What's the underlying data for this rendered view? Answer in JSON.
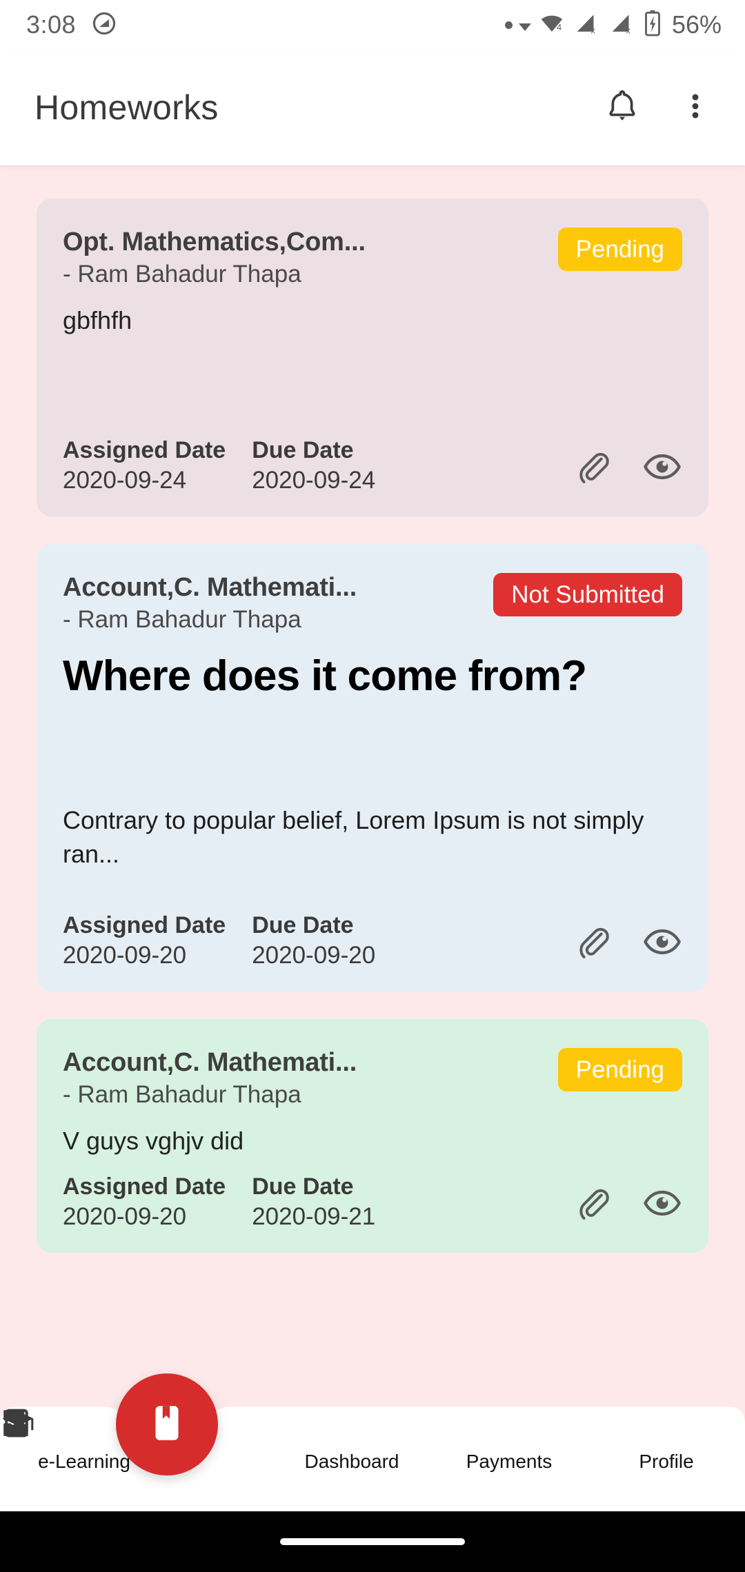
{
  "status_bar": {
    "time": "3:08",
    "battery_percent": "56%",
    "dnd_icon": "do-not-disturb-icon",
    "wifi_label": "4",
    "signal1_label": "x",
    "signal2_label": "x"
  },
  "app_bar": {
    "title": "Homeworks",
    "notification_icon": "bell-icon",
    "overflow_icon": "more-vertical-icon"
  },
  "colors": {
    "page_background": "#fde9e9",
    "badge_pending": "#ffc709",
    "badge_not_submitted": "#e03131",
    "fab": "#d62c2c",
    "card1_bg": "#ece0e4",
    "card2_bg": "#e6eef5",
    "card3_bg": "#d7f2e0"
  },
  "labels": {
    "assigned_date": "Assigned Date",
    "due_date": "Due Date",
    "attachment_icon": "paperclip-icon",
    "view_icon": "eye-icon"
  },
  "homeworks": [
    {
      "subject": "Opt. Mathematics,Com...",
      "teacher": "- Ram Bahadur Thapa",
      "status": "Pending",
      "body_plain": "gbfhfh",
      "body_heading": "",
      "body_para": "",
      "assigned_date": "2020-09-24",
      "due_date": "2020-09-24"
    },
    {
      "subject": "Account,C. Mathemati...",
      "teacher": "- Ram Bahadur Thapa",
      "status": "Not Submitted",
      "body_plain": "",
      "body_heading": "Where does it come from?",
      "body_para": "Contrary to popular belief, Lorem Ipsum is not simply ran...",
      "assigned_date": "2020-09-20",
      "due_date": "2020-09-20"
    },
    {
      "subject": "Account,C. Mathemati...",
      "teacher": "- Ram Bahadur Thapa",
      "status": "Pending",
      "body_plain": "V guys vghjv did",
      "body_heading": "",
      "body_para": "",
      "assigned_date": "2020-09-20",
      "due_date": "2020-09-21"
    }
  ],
  "bottom_nav": {
    "items": [
      {
        "label": "e-Learning",
        "icon": "graduation-cap-icon"
      },
      {
        "label": "Dashboard",
        "icon": "dashboard-grid-icon"
      },
      {
        "label": "Payments",
        "icon": "credit-card-icon"
      },
      {
        "label": "Profile",
        "icon": "person-icon"
      }
    ],
    "fab_icon": "book-bookmark-icon"
  }
}
